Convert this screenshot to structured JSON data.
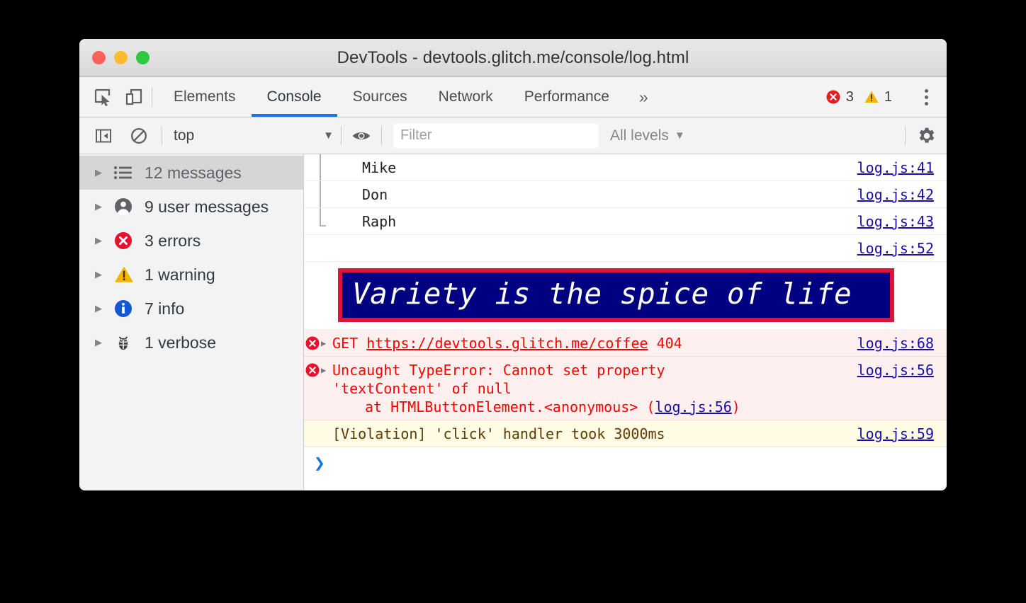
{
  "window": {
    "title": "DevTools - devtools.glitch.me/console/log.html",
    "traffic_lights": [
      "close",
      "minimize",
      "maximize"
    ]
  },
  "toolbar": {
    "inspect_icon": "inspect-cursor-icon",
    "device_icon": "device-toolbar-icon",
    "tabs": [
      {
        "label": "Elements",
        "active": false
      },
      {
        "label": "Console",
        "active": true
      },
      {
        "label": "Sources",
        "active": false
      },
      {
        "label": "Network",
        "active": false
      },
      {
        "label": "Performance",
        "active": false
      }
    ],
    "more_tabs_label": "»",
    "error_count": "3",
    "warning_count": "1",
    "menu_icon": "kebab-menu-icon"
  },
  "filterbar": {
    "sidebar_toggle_icon": "show-console-sidebar-icon",
    "clear_icon": "clear-console-icon",
    "context": "top",
    "context_caret": "▼",
    "live_expression_icon": "eye-icon",
    "filter_placeholder": "Filter",
    "filter_value": "",
    "levels_label": "All levels",
    "levels_caret": "▼",
    "settings_icon": "gear-icon"
  },
  "sidebar": {
    "items": [
      {
        "label": "12 messages",
        "icon": "list-icon",
        "selected": true,
        "triangle": "▶"
      },
      {
        "label": "9 user messages",
        "icon": "user-icon",
        "selected": false,
        "triangle": "▶"
      },
      {
        "label": "3 errors",
        "icon": "error-icon",
        "selected": false,
        "triangle": "▶"
      },
      {
        "label": "1 warning",
        "icon": "warning-icon",
        "selected": false,
        "triangle": "▶"
      },
      {
        "label": "7 info",
        "icon": "info-icon",
        "selected": false,
        "triangle": "▶"
      },
      {
        "label": "1 verbose",
        "icon": "bug-icon",
        "selected": false,
        "triangle": "▶"
      }
    ]
  },
  "console": {
    "messages": [
      {
        "text": "Mike",
        "source": "log.js:41",
        "level": "log",
        "grouped": true
      },
      {
        "text": "Don",
        "source": "log.js:42",
        "level": "log",
        "grouped": true
      },
      {
        "text": "Raph",
        "source": "log.js:43",
        "level": "log",
        "grouped": true
      },
      {
        "text": "",
        "source": "log.js:52",
        "level": "log",
        "grouped": false
      }
    ],
    "banner": {
      "text": "Variety is the spice of life",
      "background_color": "#000080",
      "border_color": "#dc143c",
      "text_color": "#ffffff"
    },
    "error_network": {
      "triangle": "▶",
      "method": "GET",
      "url": "https://devtools.glitch.me/coffee",
      "status": "404",
      "source": "log.js:68",
      "icon": "error-icon"
    },
    "error_type": {
      "triangle": "▶",
      "line1": "Uncaught TypeError: Cannot set property",
      "line2": "'textContent' of null",
      "line3_prefix": "at HTMLButtonElement.<anonymous> (",
      "line3_link": "log.js:56",
      "line3_suffix": ")",
      "source": "log.js:56",
      "icon": "error-icon"
    },
    "violation": {
      "text": "[Violation] 'click' handler took 3000ms",
      "source": "log.js:59",
      "level": "warning"
    },
    "prompt_chevron": "❯"
  },
  "colors": {
    "accent": "#1a73e8",
    "error": "#ff0000",
    "error_badge": "#e02020",
    "warning": "#f2b705",
    "info": "#1a73e8",
    "link": "#1a0dab",
    "banner_bg": "#000080",
    "banner_border": "#dc143c"
  }
}
